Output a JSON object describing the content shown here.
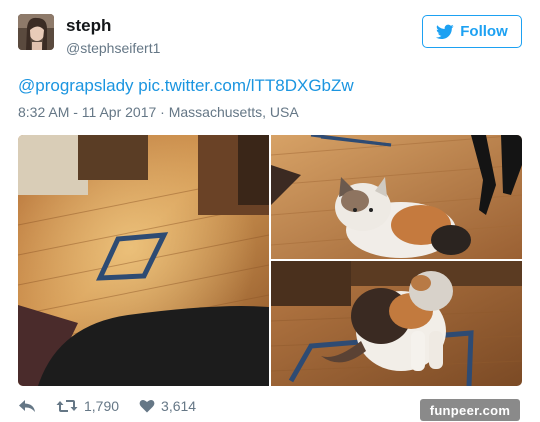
{
  "tweet": {
    "author": {
      "display_name": "steph",
      "handle": "@stephseifert1",
      "avatar_icon": "user-avatar"
    },
    "follow_label": "Follow",
    "text_mention": "@prograpslady",
    "text_link": "pic.twitter.com/lTT8DXGbZw",
    "timestamp": "8:32 AM - 11 Apr 2017",
    "separator": "·",
    "location": "Massachusetts, USA",
    "media": [
      {
        "subject": "taped square on wood floor"
      },
      {
        "subject": "calico cat lying on floor"
      },
      {
        "subject": "calico cat sitting in taped square"
      }
    ],
    "actions": {
      "reply_icon": "reply-icon",
      "retweet_icon": "retweet-icon",
      "retweet_count": "1,790",
      "like_icon": "heart-icon",
      "like_count": "3,614"
    }
  },
  "watermark": "funpeer.com",
  "colors": {
    "accent": "#1da1f2",
    "link": "#1b95e0",
    "muted": "#657786",
    "text": "#14171a"
  }
}
